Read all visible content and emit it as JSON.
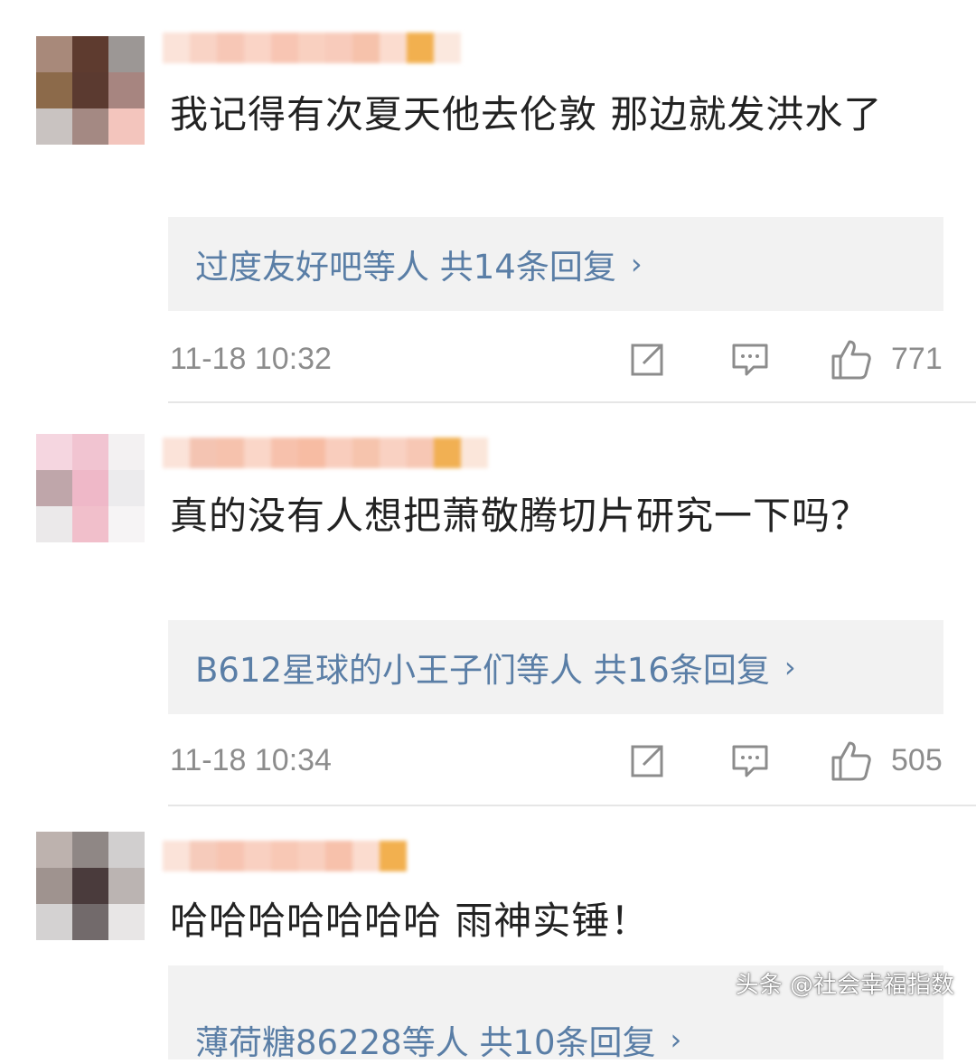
{
  "comments": [
    {
      "text": "我记得有次夏天他去伦敦 那边就发洪水了",
      "reply_summary": "过度友好吧等人  共14条回复",
      "time": "11-18 10:32",
      "likes": "771",
      "avatar_colors": [
        "#a8897a",
        "#5e3b2f",
        "#9c9795",
        "#8c6a4a",
        "#5b3a30",
        "#a78580",
        "#c9c3c1",
        "#a48983",
        "#f3c5bd"
      ]
    },
    {
      "text": "真的没有人想把萧敬腾切片研究一下吗？",
      "reply_summary": "B612星球的小王子们等人  共16条回复",
      "time": "11-18 10:34",
      "likes": "505",
      "avatar_colors": [
        "#f5d6e0",
        "#f1c4d1",
        "#f3f1f2",
        "#bfa6aa",
        "#efb8c8",
        "#ecebed",
        "#ebe9ea",
        "#f1bfcb",
        "#f6f4f5"
      ]
    },
    {
      "text": "哈哈哈哈哈哈哈 雨神实锤！",
      "reply_summary": "薄荷糖86228等人  共10条回复",
      "avatar_colors": [
        "#bdb2ae",
        "#8f8785",
        "#d1cfcf",
        "#9f938f",
        "#4a3b3c",
        "#bbb4b2",
        "#d4d2d2",
        "#726a6b",
        "#e8e6e6"
      ]
    }
  ],
  "icons": {
    "share": "share-edit-icon",
    "comment": "comment-bubble-icon",
    "like": "thumbs-up-icon"
  },
  "colors": {
    "reply_link": "#5a7ea6",
    "reply_bg": "#f2f2f2",
    "meta_gray": "#8c8c8c"
  },
  "watermark": "头条 @社会幸福指数"
}
